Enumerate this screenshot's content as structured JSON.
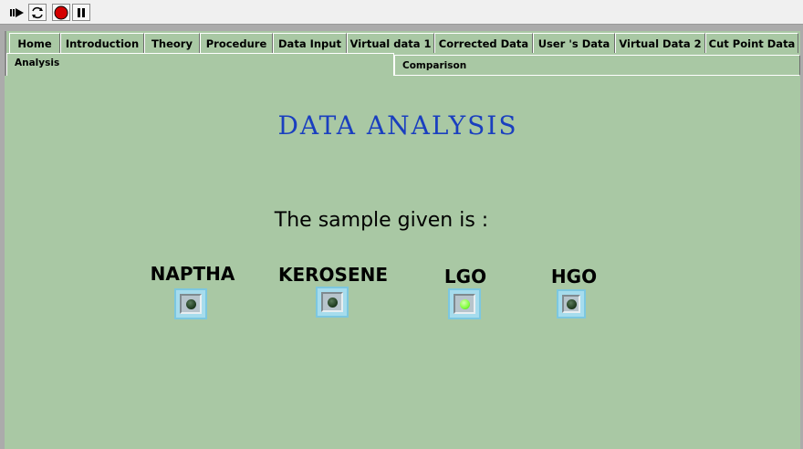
{
  "toolbar": {
    "buttons": [
      {
        "name": "run-arrow-icon"
      },
      {
        "name": "run-continuously-icon"
      },
      {
        "name": "abort-icon"
      },
      {
        "name": "pause-icon"
      }
    ]
  },
  "tabs_row1": [
    "Home",
    "Introduction",
    "Theory",
    "Procedure",
    "Data Input",
    "Virtual data 1",
    "Corrected Data",
    "User 's Data",
    "Virtual Data 2",
    "Cut Point Data"
  ],
  "tabs_row2": [
    "Analysis",
    "Comparison"
  ],
  "active_tab": "Analysis",
  "main": {
    "title": "DATA ANALYSIS",
    "subtitle": "The sample given is :"
  },
  "indicators": [
    {
      "label": "NAPTHA",
      "on": false
    },
    {
      "label": "KEROSENE",
      "on": false
    },
    {
      "label": "LGO",
      "on": true
    },
    {
      "label": "HGO",
      "on": false
    }
  ],
  "colors": {
    "background": "#a9c8a4",
    "title": "#1a3fbf",
    "led_off": "#1f3b1f",
    "led_on": "#7fff3a",
    "led_bezel": "#a6dced"
  }
}
